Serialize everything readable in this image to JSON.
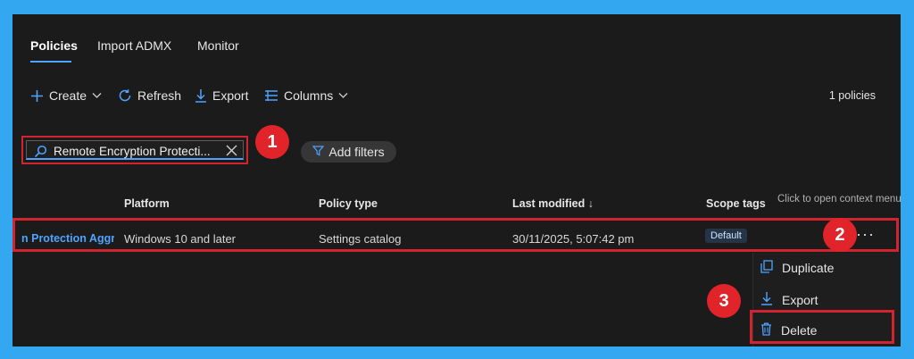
{
  "tabs": [
    {
      "label": "Policies"
    },
    {
      "label": "Import ADMX"
    },
    {
      "label": "Monitor"
    }
  ],
  "toolbar": {
    "create_label": "Create",
    "refresh_label": "Refresh",
    "export_label": "Export",
    "columns_label": "Columns",
    "count_text": "1 policies"
  },
  "search": {
    "value": "Remote Encryption Protecti..."
  },
  "filters": {
    "add_filters_label": "Add filters"
  },
  "table": {
    "headers": {
      "platform": "Platform",
      "policy_type": "Policy type",
      "last_modified": "Last modified",
      "scope_tags": "Scope tags"
    },
    "rows": [
      {
        "name": "n Protection Aggr",
        "platform": "Windows 10 and later",
        "policy_type": "Settings catalog",
        "last_modified": "30/11/2025, 5:07:42 pm",
        "scope_tag": "Default"
      }
    ]
  },
  "tooltip": "Click to open context menu",
  "context_menu": {
    "items": [
      {
        "label": "Duplicate",
        "icon": "duplicate-icon"
      },
      {
        "label": "Export",
        "icon": "download-icon"
      },
      {
        "label": "Delete",
        "icon": "trash-icon"
      }
    ]
  },
  "step_badges": [
    "1",
    "2",
    "3"
  ],
  "colors": {
    "accent": "#4fa3ff",
    "highlight": "#d1242f",
    "badge": "#e0242a",
    "background": "#1b1b1b",
    "frame": "#33a8f0"
  }
}
